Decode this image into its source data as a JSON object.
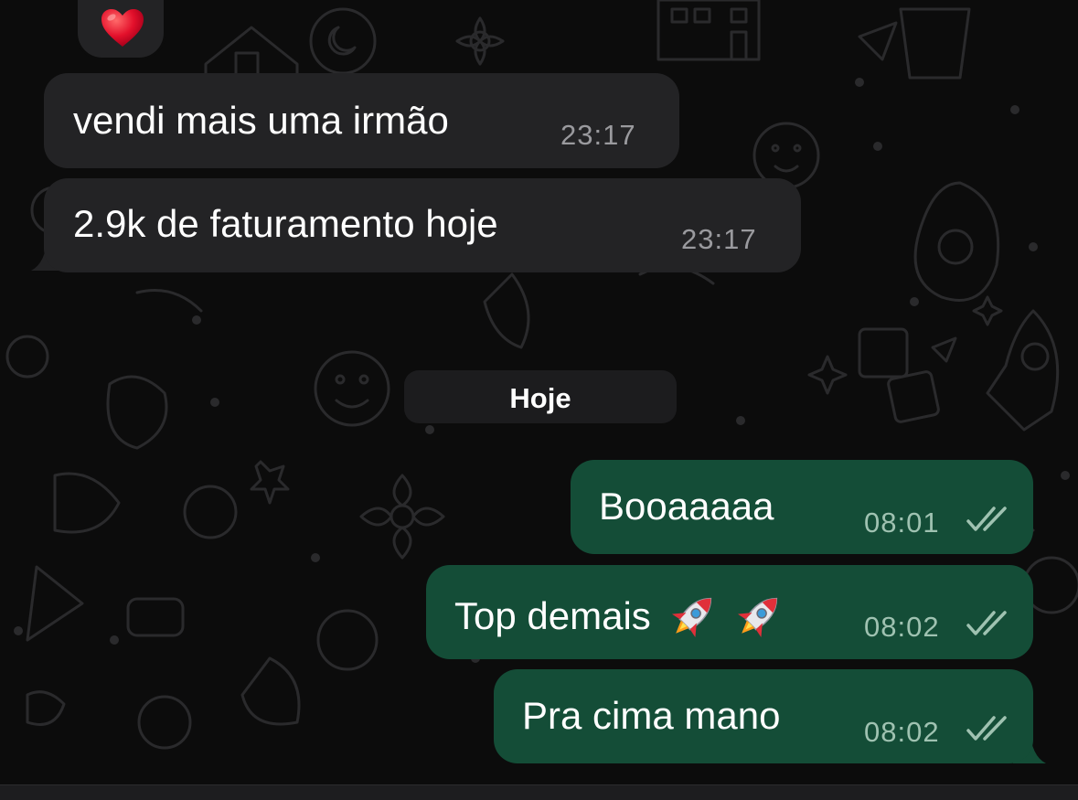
{
  "reaction": {
    "emoji_icon": "red-heart-icon"
  },
  "incoming_messages": [
    {
      "text": "vendi mais uma irmão",
      "time": "23:17"
    },
    {
      "text": "2.9k de faturamento hoje",
      "time": "23:17"
    }
  ],
  "date_separator": {
    "label": "Hoje"
  },
  "outgoing_messages": [
    {
      "text": "Booaaaaa",
      "time": "08:01",
      "status": "read-double-check"
    },
    {
      "text": "Top demais",
      "emoji": "🚀🚀",
      "time": "08:02",
      "status": "read-double-check"
    },
    {
      "text": "Pra cima mano",
      "time": "08:02",
      "status": "read-double-check"
    }
  ],
  "colors": {
    "background": "#0c0c0c",
    "incoming_bubble": "#232325",
    "outgoing_bubble": "#144d37",
    "text": "#ffffff",
    "incoming_time": "#9a9a9e",
    "outgoing_time": "#9fc2b1"
  }
}
